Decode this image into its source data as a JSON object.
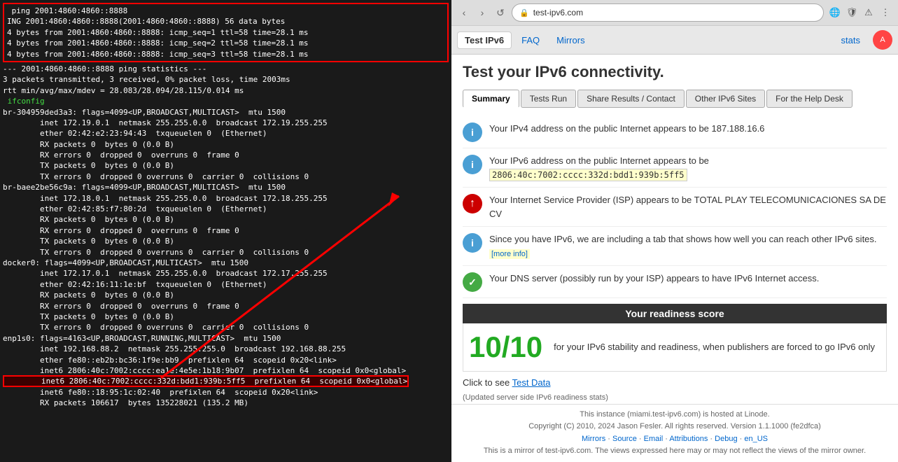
{
  "terminal": {
    "lines": [
      {
        "text": " ping 2001:4860:4860::8888",
        "class": "t-white",
        "redbox_start": true
      },
      {
        "text": "ING 2001:4860:4860::8888(2001:4860:4860::8888) 56 data bytes",
        "class": "t-white"
      },
      {
        "text": "4 bytes from 2001:4860:4860::8888: icmp_seq=1 ttl=58 time=28.1 ms",
        "class": "t-white"
      },
      {
        "text": "4 bytes from 2001:4860:4860::8888: icmp_seq=2 ttl=58 time=28.1 ms",
        "class": "t-white"
      },
      {
        "text": "4 bytes from 2001:4860:4860::8888: icmp_seq=3 ttl=58 time=28.1 ms",
        "class": "t-white",
        "redbox_end": true
      },
      {
        "text": "--- 2001:4860:4860::8888 ping statistics ---",
        "class": "t-white"
      },
      {
        "text": "3 packets transmitted, 3 received, 0% packet loss, time 2003ms",
        "class": "t-white"
      },
      {
        "text": "rtt min/avg/max/mdev = 28.083/28.094/28.115/0.014 ms",
        "class": "t-white"
      },
      {
        "text": " ifconfig",
        "class": "t-green"
      },
      {
        "text": "br-304959ded3a3: flags=4099<UP,BROADCAST,MULTICAST>  mtu 1500",
        "class": "t-white"
      },
      {
        "text": "        inet 172.19.0.1  netmask 255.255.0.0  broadcast 172.19.255.255",
        "class": "t-white"
      },
      {
        "text": "        ether 02:42:e2:23:94:43  txqueuelen 0  (Ethernet)",
        "class": "t-white"
      },
      {
        "text": "        RX packets 0  bytes 0 (0.0 B)",
        "class": "t-white"
      },
      {
        "text": "        RX errors 0  dropped 0  overruns 0  frame 0",
        "class": "t-white"
      },
      {
        "text": "        TX packets 0  bytes 0 (0.0 B)",
        "class": "t-white"
      },
      {
        "text": "        TX errors 0  dropped 0 overruns 0  carrier 0  collisions 0",
        "class": "t-white"
      },
      {
        "text": "br-baee2be56c9a: flags=4099<UP,BROADCAST,MULTICAST>  mtu 1500",
        "class": "t-white"
      },
      {
        "text": "        inet 172.18.0.1  netmask 255.255.0.0  broadcast 172.18.255.255",
        "class": "t-white"
      },
      {
        "text": "        ether 02:42:85:f7:80:2d  txqueuelen 0  (Ethernet)",
        "class": "t-white"
      },
      {
        "text": "        RX packets 0  bytes 0 (0.0 B)",
        "class": "t-white"
      },
      {
        "text": "        RX errors 0  dropped 0  overruns 0  frame 0",
        "class": "t-white"
      },
      {
        "text": "        TX packets 0  bytes 0 (0.0 B)",
        "class": "t-white"
      },
      {
        "text": "        TX errors 0  dropped 0 overruns 0  carrier 0  collisions 0",
        "class": "t-white"
      },
      {
        "text": "docker0: flags=4099<UP,BROADCAST,MULTICAST>  mtu 1500",
        "class": "t-white"
      },
      {
        "text": "        inet 172.17.0.1  netmask 255.255.0.0  broadcast 172.17.255.255",
        "class": "t-white"
      },
      {
        "text": "        ether 02:42:16:11:1e:bf  txqueuelen 0  (Ethernet)",
        "class": "t-white"
      },
      {
        "text": "        RX packets 0  bytes 0 (0.0 B)",
        "class": "t-white"
      },
      {
        "text": "        RX errors 0  dropped 0  overruns 0  frame 0",
        "class": "t-white"
      },
      {
        "text": "        TX packets 0  bytes 0 (0.0 B)",
        "class": "t-white"
      },
      {
        "text": "        TX errors 0  dropped 0 overruns 0  carrier 0  collisions 0",
        "class": "t-white"
      },
      {
        "text": "enp1s0: flags=4163<UP,BROADCAST,RUNNING,MULTICAST>  mtu 1500",
        "class": "t-white"
      },
      {
        "text": "        inet 192.168.88.2  netmask 255.255.255.0  broadcast 192.168.88.255",
        "class": "t-white"
      },
      {
        "text": "        ether fe80::eb2b:bc36:1f9e:bb9  prefixlen 64  scopeid 0x20<link>",
        "class": "t-white"
      },
      {
        "text": "        inet6 2806:40c:7002:cccc:ea1e:4e5e:1b18:9b07  prefixlen 64  scopeid 0x0<global>",
        "class": "t-white"
      },
      {
        "text": "        inet6 2806:40c:7002:cccc:332d:bdd1:939b:5ff5  prefixlen 64  scopeid 0x0<global>",
        "class": "t-white",
        "highlight": true
      },
      {
        "text": "        inet6 fe80::18:95:1c:02:40  prefixlen 64  scopeid 0x20<link>",
        "class": "t-white"
      },
      {
        "text": "        RX packets 106617  bytes 135228021 (135.2 MB)",
        "class": "t-white"
      }
    ]
  },
  "browser": {
    "nav_back": "‹",
    "nav_forward": "›",
    "nav_refresh": "↺",
    "address": "test-ipv6.com",
    "site_nav": [
      {
        "label": "Test IPv6",
        "active": true
      },
      {
        "label": "FAQ",
        "active": false
      },
      {
        "label": "Mirrors",
        "active": false
      }
    ],
    "stats_label": "stats",
    "page_title": "Test your IPv6 connectivity.",
    "tabs": [
      {
        "label": "Summary",
        "active": true
      },
      {
        "label": "Tests Run",
        "active": false
      },
      {
        "label": "Share Results / Contact",
        "active": false
      },
      {
        "label": "Other IPv6 Sites",
        "active": false
      },
      {
        "label": "For the Help Desk",
        "active": false
      }
    ],
    "info_items": [
      {
        "icon": "i",
        "icon_class": "blue",
        "text": "Your IPv4 address on the public Internet appears to be 187.188.16.6"
      },
      {
        "icon": "i",
        "icon_class": "blue",
        "text_before": "Your IPv6 address on the public Internet appears to be ",
        "ipv6": "2806:40c:7002:cccc:332d:bdd1:939b:5ff5",
        "text_after": ""
      },
      {
        "icon": "↑",
        "icon_class": "red-arrow-icon",
        "text": "Your Internet Service Provider (ISP) appears to be TOTAL PLAY TELECOMUNICACIONES SA DE CV"
      },
      {
        "icon": "i",
        "icon_class": "blue",
        "text_before": "Since you have IPv6, we are including a tab that shows how well you can reach other IPv6 sites. ",
        "more_info": "[more info]",
        "text_after": ""
      },
      {
        "icon": "✓",
        "icon_class": "green",
        "text": "Your DNS server (possibly run by your ISP) appears to have IPv6 Internet access."
      }
    ],
    "readiness": {
      "header": "Your readiness score",
      "score": "10/10",
      "description": "for your IPv6 stability and readiness, when publishers are forced to go IPv6 only"
    },
    "test_data_label": "Click to see",
    "test_data_link": "Test Data",
    "updated_text": "(Updated server side IPv6 readiness stats)",
    "footer": {
      "hosted": "This instance (miami.test-ipv6.com) is hosted at Linode.",
      "copyright": "Copyright (C) 2010, 2024 Jason Fesler. All rights reserved. Version 1.1.1000 (fe2dfca)",
      "links": [
        "Mirrors",
        "Source",
        "Email",
        "Attributions",
        "Debug"
      ],
      "locale": "en_US",
      "mirror_notice": "This is a mirror of test-ipv6.com. The views expressed here may or may not reflect the views of the mirror owner."
    }
  }
}
